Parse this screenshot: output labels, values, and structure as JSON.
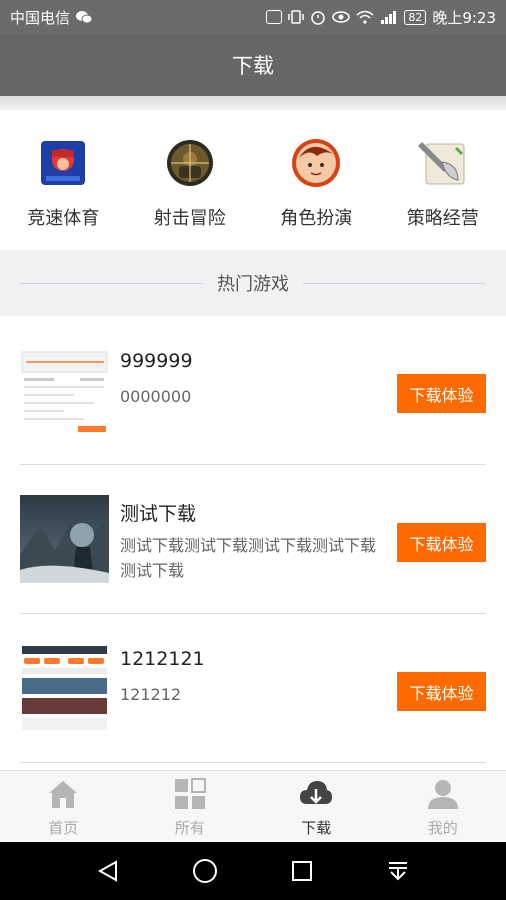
{
  "status": {
    "carrier": "中国电信",
    "battery": "82",
    "time": "晚上9:23"
  },
  "title": "下载",
  "categories": [
    {
      "label": "竞速体育",
      "icon": "racing-game-icon"
    },
    {
      "label": "射击冒险",
      "icon": "shooter-game-icon"
    },
    {
      "label": "角色扮演",
      "icon": "rpg-game-icon"
    },
    {
      "label": "策略经营",
      "icon": "strategy-game-icon"
    }
  ],
  "section_title": "热门游戏",
  "games": [
    {
      "name": "999999",
      "desc": "0000000",
      "button": "下载体验"
    },
    {
      "name": "测试下载",
      "desc": "测试下载测试下载测试下载测试下载测试下载",
      "button": "下载体验"
    },
    {
      "name": "1212121",
      "desc": "121212",
      "button": "下载体验"
    }
  ],
  "tabs": [
    {
      "label": "首页",
      "icon": "home-icon"
    },
    {
      "label": "所有",
      "icon": "grid-icon"
    },
    {
      "label": "下载",
      "icon": "cloud-download-icon",
      "active": true
    },
    {
      "label": "我的",
      "icon": "user-icon"
    }
  ],
  "colors": {
    "accent": "#ff6a00",
    "header": "#676767"
  }
}
